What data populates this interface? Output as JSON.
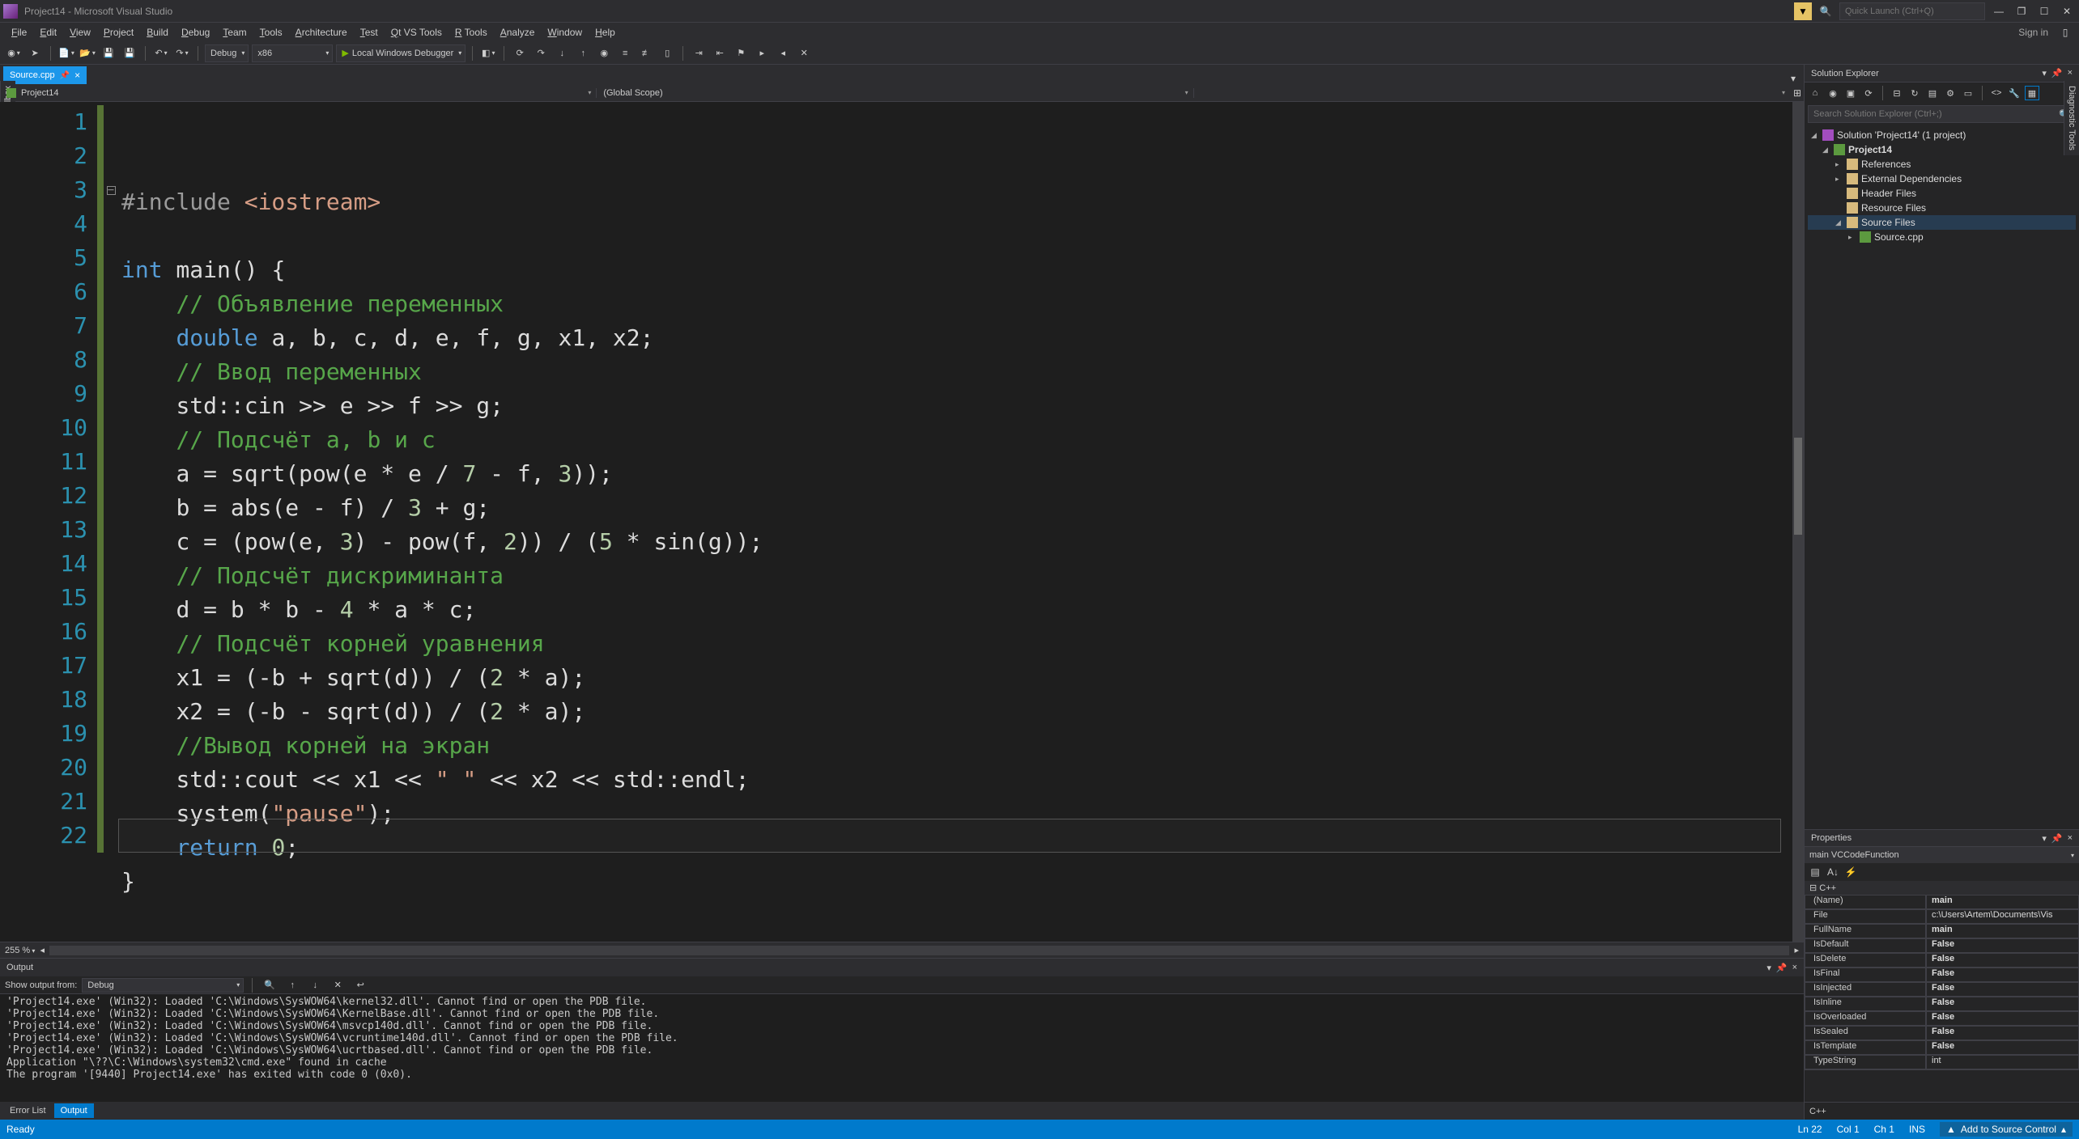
{
  "title": "Project14 - Microsoft Visual Studio",
  "quick_launch_placeholder": "Quick Launch (Ctrl+Q)",
  "menu": [
    "File",
    "Edit",
    "View",
    "Project",
    "Build",
    "Debug",
    "Team",
    "Tools",
    "Architecture",
    "Test",
    "Qt VS Tools",
    "R Tools",
    "Analyze",
    "Window",
    "Help"
  ],
  "signin": "Sign in",
  "toolbar": {
    "config": "Debug",
    "platform": "x86",
    "debugger": "Local Windows Debugger"
  },
  "doctab": {
    "name": "Source.cpp"
  },
  "navbar": {
    "project": "Project14",
    "scope": "(Global Scope)",
    "func": ""
  },
  "zoom": "255 %",
  "code": {
    "lines": [
      {
        "n": 1,
        "h": "<span class='tok-pre'>#include </span><span class='tok-inc'>&lt;iostream&gt;</span>"
      },
      {
        "n": 2,
        "h": ""
      },
      {
        "n": 3,
        "h": "<span class='tok-kw'>int</span><span class='tok-id'> main() {</span>",
        "fold": true
      },
      {
        "n": 4,
        "h": "    <span class='tok-cm'>// Объявление переменных</span>"
      },
      {
        "n": 5,
        "h": "    <span class='tok-kw'>double</span><span class='tok-id'> a, b, c, d, e, f, g, x1, x2;</span>"
      },
      {
        "n": 6,
        "h": "    <span class='tok-cm'>// Ввод переменных</span>"
      },
      {
        "n": 7,
        "h": "    <span class='tok-id'>std::cin &gt;&gt; e &gt;&gt; f &gt;&gt; g;</span>"
      },
      {
        "n": 8,
        "h": "    <span class='tok-cm'>// Подсчёт a, b и c</span>"
      },
      {
        "n": 9,
        "h": "    <span class='tok-id'>a = sqrt(pow(e * e / </span><span class='tok-num'>7</span><span class='tok-id'> - f, </span><span class='tok-num'>3</span><span class='tok-id'>));</span>"
      },
      {
        "n": 10,
        "h": "    <span class='tok-id'>b = abs(e - f) / </span><span class='tok-num'>3</span><span class='tok-id'> + g;</span>"
      },
      {
        "n": 11,
        "h": "    <span class='tok-id'>c = (pow(e, </span><span class='tok-num'>3</span><span class='tok-id'>) - pow(f, </span><span class='tok-num'>2</span><span class='tok-id'>)) / (</span><span class='tok-num'>5</span><span class='tok-id'> * sin(g));</span>"
      },
      {
        "n": 12,
        "h": "    <span class='tok-cm'>// Подсчёт дискриминанта</span>"
      },
      {
        "n": 13,
        "h": "    <span class='tok-id'>d = b * b - </span><span class='tok-num'>4</span><span class='tok-id'> * a * c;</span>"
      },
      {
        "n": 14,
        "h": "    <span class='tok-cm'>// Подсчёт корней уравнения</span>"
      },
      {
        "n": 15,
        "h": "    <span class='tok-id'>x1 = (-b + sqrt(d)) / (</span><span class='tok-num'>2</span><span class='tok-id'> * a);</span>"
      },
      {
        "n": 16,
        "h": "    <span class='tok-id'>x2 = (-b - sqrt(d)) / (</span><span class='tok-num'>2</span><span class='tok-id'> * a);</span>"
      },
      {
        "n": 17,
        "h": "    <span class='tok-cm'>//Вывод корней на экран</span>"
      },
      {
        "n": 18,
        "h": "    <span class='tok-id'>std::cout &lt;&lt; x1 &lt;&lt; </span><span class='tok-str'>\" \"</span><span class='tok-id'> &lt;&lt; x2 &lt;&lt; std::endl;</span>"
      },
      {
        "n": 19,
        "h": "    <span class='tok-id'>system(</span><span class='tok-str'>\"pause\"</span><span class='tok-id'>);</span>"
      },
      {
        "n": 20,
        "h": "    <span class='tok-kw'>return</span><span class='tok-id'> </span><span class='tok-num'>0</span><span class='tok-id'>;</span>"
      },
      {
        "n": 21,
        "h": "<span class='tok-id'>}</span>"
      },
      {
        "n": 22,
        "h": ""
      }
    ],
    "current_line_index": 21
  },
  "output": {
    "title": "Output",
    "from_label": "Show output from:",
    "from_value": "Debug",
    "lines": [
      "'Project14.exe' (Win32): Loaded 'C:\\Windows\\SysWOW64\\kernel32.dll'. Cannot find or open the PDB file.",
      "'Project14.exe' (Win32): Loaded 'C:\\Windows\\SysWOW64\\KernelBase.dll'. Cannot find or open the PDB file.",
      "'Project14.exe' (Win32): Loaded 'C:\\Windows\\SysWOW64\\msvcp140d.dll'. Cannot find or open the PDB file.",
      "'Project14.exe' (Win32): Loaded 'C:\\Windows\\SysWOW64\\vcruntime140d.dll'. Cannot find or open the PDB file.",
      "'Project14.exe' (Win32): Loaded 'C:\\Windows\\SysWOW64\\ucrtbased.dll'. Cannot find or open the PDB file.",
      "Application \"\\??\\C:\\Windows\\system32\\cmd.exe\" found in cache",
      "The program '[9440] Project14.exe' has exited with code 0 (0x0)."
    ],
    "tabs": [
      "Error List",
      "Output"
    ],
    "active_tab": 1
  },
  "solution_explorer": {
    "title": "Solution Explorer",
    "search_placeholder": "Search Solution Explorer (Ctrl+;)",
    "solution": "Solution 'Project14' (1 project)",
    "project": "Project14",
    "nodes": [
      "References",
      "External Dependencies",
      "Header Files",
      "Resource Files",
      "Source Files"
    ],
    "source_file": "Source.cpp"
  },
  "properties": {
    "title": "Properties",
    "subject": "main VCCodeFunction",
    "category": "C++",
    "rows": [
      {
        "k": "(Name)",
        "v": "main"
      },
      {
        "k": "File",
        "v": "c:\\Users\\Artem\\Documents\\Vis"
      },
      {
        "k": "FullName",
        "v": "main"
      },
      {
        "k": "IsDefault",
        "v": "False"
      },
      {
        "k": "IsDelete",
        "v": "False"
      },
      {
        "k": "IsFinal",
        "v": "False"
      },
      {
        "k": "IsInjected",
        "v": "False"
      },
      {
        "k": "IsInline",
        "v": "False"
      },
      {
        "k": "IsOverloaded",
        "v": "False"
      },
      {
        "k": "IsSealed",
        "v": "False"
      },
      {
        "k": "IsTemplate",
        "v": "False"
      },
      {
        "k": "TypeString",
        "v": "int"
      }
    ]
  },
  "right_side_tab": "Diagnostic Tools",
  "left_side_tab": "Toolbox",
  "cpp_tab": "C++",
  "status": {
    "ready": "Ready",
    "ln": "Ln 22",
    "col": "Col 1",
    "ch": "Ch 1",
    "ins": "INS",
    "src": "Add to Source Control"
  }
}
